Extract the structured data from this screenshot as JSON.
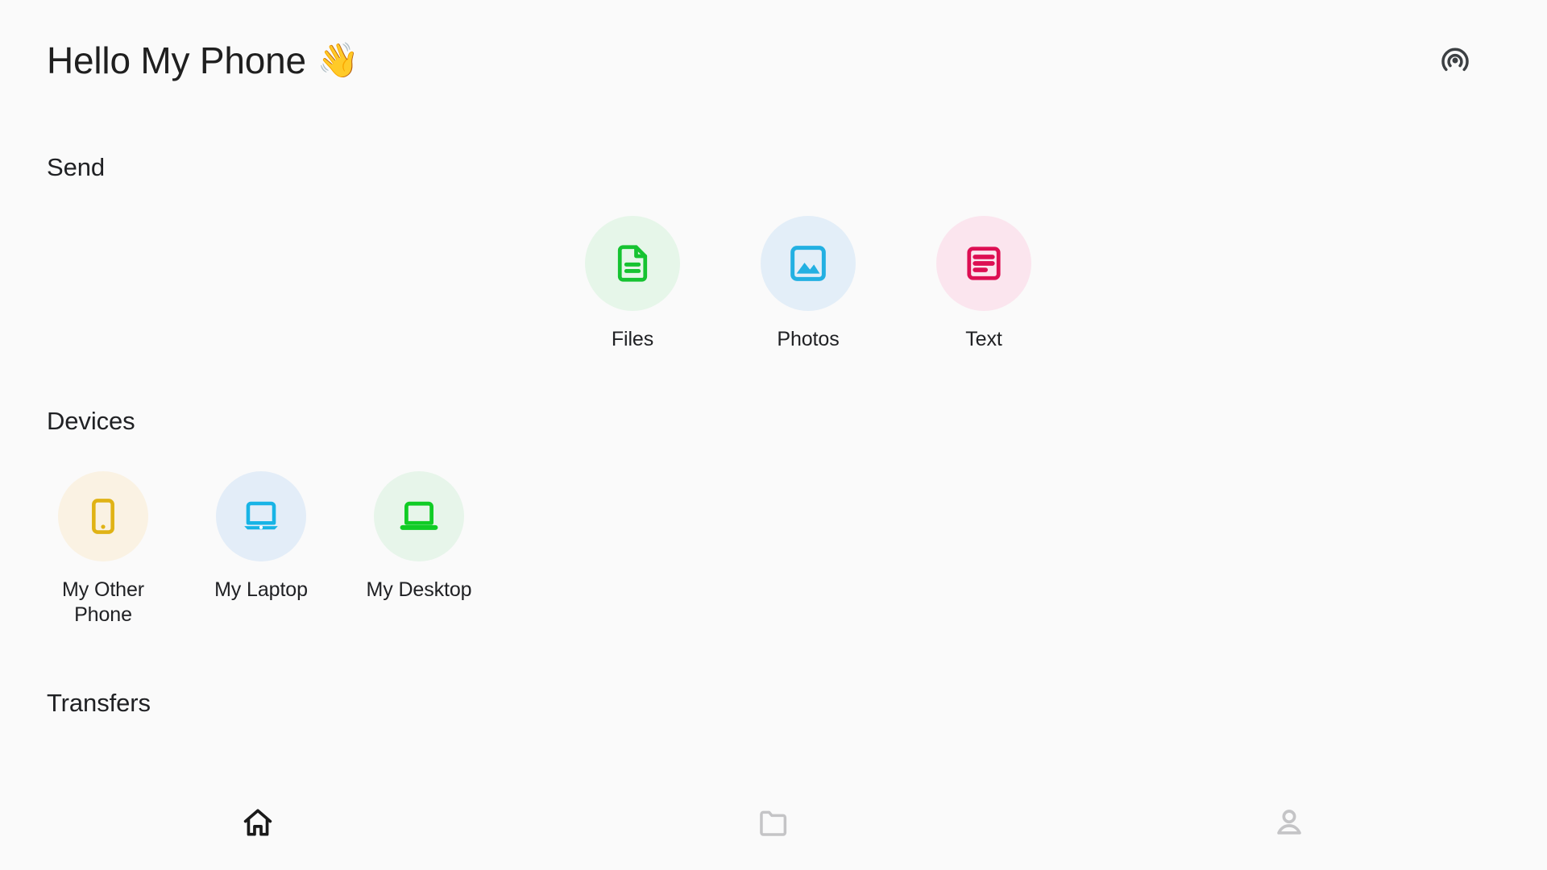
{
  "header": {
    "title": "Hello My Phone",
    "title_emoji": "👋",
    "nearby_icon": "nearby-share-icon"
  },
  "colors": {
    "background": "#FAFAFA",
    "text_primary": "#202124",
    "files_accent": "#16C331",
    "files_bg": "#E6F6E9",
    "photos_accent": "#23B0E2",
    "photos_bg": "#E3EEF8",
    "text_accent": "#DD0F53",
    "text_bg": "#FBE5EE",
    "phone_accent": "#E0B315",
    "phone_bg": "#FAF2E3",
    "laptop_accent": "#18B4E6",
    "laptop_bg": "#E3EDF8",
    "desktop_accent": "#10CC25",
    "desktop_bg": "#E7F5EA",
    "nav_active": "#1A1A1A",
    "nav_inactive": "#C4C4C6"
  },
  "send": {
    "heading": "Send",
    "items": [
      {
        "label": "Files",
        "icon": "document-icon"
      },
      {
        "label": "Photos",
        "icon": "image-icon"
      },
      {
        "label": "Text",
        "icon": "text-lines-icon"
      }
    ]
  },
  "devices": {
    "heading": "Devices",
    "items": [
      {
        "label": "My Other Phone",
        "icon": "smartphone-icon"
      },
      {
        "label": "My Laptop",
        "icon": "laptop-icon"
      },
      {
        "label": "My Desktop",
        "icon": "desktop-icon"
      }
    ]
  },
  "transfers": {
    "heading": "Transfers"
  },
  "bottom_nav": {
    "items": [
      {
        "name": "home",
        "icon": "home-icon",
        "active": true
      },
      {
        "name": "files",
        "icon": "folder-icon",
        "active": false
      },
      {
        "name": "profile",
        "icon": "person-icon",
        "active": false
      }
    ]
  }
}
